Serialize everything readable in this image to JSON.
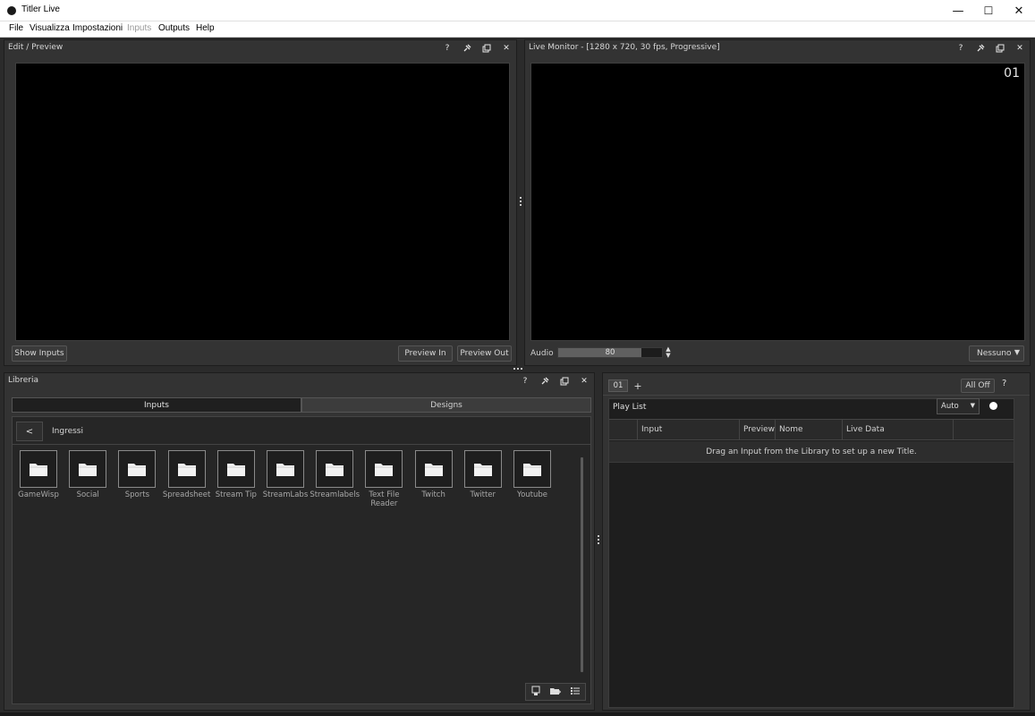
{
  "window": {
    "title": "Titler Live",
    "minimize": "—",
    "maximize": "☐",
    "close": "✕"
  },
  "menu": [
    {
      "label": "File",
      "enabled": true
    },
    {
      "label": "Visualizza",
      "enabled": true
    },
    {
      "label": "Impostazioni",
      "enabled": true
    },
    {
      "label": "Inputs",
      "enabled": false
    },
    {
      "label": "Outputs",
      "enabled": true
    },
    {
      "label": "Help",
      "enabled": true
    }
  ],
  "panel_tools": {
    "help": "?",
    "pin": "✎",
    "float": "⧉",
    "close": "✕"
  },
  "preview": {
    "title": "Edit / Preview",
    "show_inputs": "Show Inputs",
    "preview_in": "Preview In",
    "preview_out": "Preview Out"
  },
  "live": {
    "title": "Live Monitor - [1280 x 720, 30 fps, Progressive]",
    "channel": "01",
    "audio_label": "Audio",
    "audio_value": "80",
    "audio_level": 0.8,
    "output_select": "Nessuno"
  },
  "library": {
    "title": "Libreria",
    "tabs": [
      {
        "label": "Inputs",
        "active": true
      },
      {
        "label": "Designs",
        "active": false
      }
    ],
    "back": "<",
    "path": "Ingressi",
    "folders": [
      {
        "label": "GameWisp"
      },
      {
        "label": "Social"
      },
      {
        "label": "Sports"
      },
      {
        "label": "Spreadsheet"
      },
      {
        "label": "Stream Tip"
      },
      {
        "label": "StreamLabs"
      },
      {
        "label": "Streamlabels"
      },
      {
        "label": "Text File Reader"
      },
      {
        "label": "Twitch"
      },
      {
        "label": "Twitter"
      },
      {
        "label": "Youtube"
      }
    ]
  },
  "playlist": {
    "tab": "01",
    "add_tab": "+",
    "all_off": "All Off",
    "help": "?",
    "label": "Play List",
    "mode": "Auto",
    "columns": [
      "",
      "Input",
      "Preview",
      "Nome",
      "Live Data",
      ""
    ],
    "empty_message": "Drag an Input from the Library to set up a new Title."
  }
}
